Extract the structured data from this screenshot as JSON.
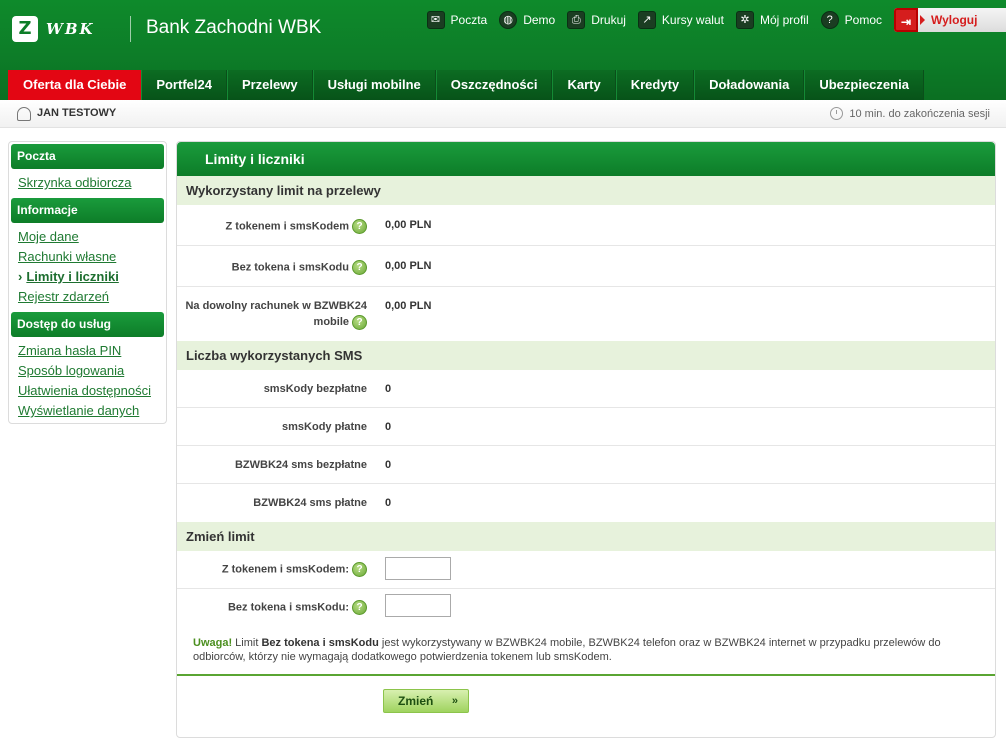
{
  "header": {
    "logo_mark": "Z",
    "logo_wordmark": "WBK",
    "bank_name": "Bank Zachodni WBK",
    "top_links": [
      {
        "label": "Poczta",
        "icon": "envelope-icon",
        "glyph": "✉"
      },
      {
        "label": "Demo",
        "icon": "globe-icon",
        "glyph": "◍"
      },
      {
        "label": "Drukuj",
        "icon": "printer-icon",
        "glyph": "⎙"
      },
      {
        "label": "Kursy walut",
        "icon": "chart-icon",
        "glyph": "↗"
      },
      {
        "label": "Mój profil",
        "icon": "gear-icon",
        "glyph": "✲"
      },
      {
        "label": "Pomoc",
        "icon": "help-icon",
        "glyph": "?"
      }
    ],
    "logout": {
      "label": "Wyloguj",
      "icon": "logout-icon",
      "glyph": "⇥"
    }
  },
  "nav": {
    "tabs": [
      {
        "label": "Oferta dla Ciebie",
        "active": true
      },
      {
        "label": "Portfel24"
      },
      {
        "label": "Przelewy"
      },
      {
        "label": "Usługi mobilne"
      },
      {
        "label": "Oszczędności"
      },
      {
        "label": "Karty"
      },
      {
        "label": "Kredyty"
      },
      {
        "label": "Doładowania"
      },
      {
        "label": "Ubezpieczenia"
      }
    ]
  },
  "userbar": {
    "user_name": "JAN TESTOWY",
    "session": "10 min. do zakończenia sesji"
  },
  "sidebar": {
    "groups": [
      {
        "title": "Poczta",
        "items": [
          "Skrzynka odbiorcza"
        ]
      },
      {
        "title": "Informacje",
        "items": [
          "Moje dane",
          "Rachunki własne",
          "Limity i liczniki",
          "Rejestr zdarzeń"
        ]
      },
      {
        "title": "Dostęp do usług",
        "items": [
          "Zmiana hasła PIN",
          "Sposób logowania",
          "Ułatwienia dostępności",
          "Wyświetlanie danych"
        ]
      }
    ],
    "active_item": "Limity i liczniki",
    "active_chevron": "›"
  },
  "main": {
    "title": "Limity i liczniki",
    "section1": {
      "title": "Wykorzystany limit na przelewy",
      "rows": [
        {
          "label": "Z tokenem i smsKodem",
          "value": "0,00 PLN"
        },
        {
          "label": "Bez tokena i smsKodu",
          "value": "0,00 PLN"
        },
        {
          "label": "Na dowolny rachunek w BZWBK24 mobile",
          "value": "0,00 PLN"
        }
      ]
    },
    "section2": {
      "title": "Liczba wykorzystanych SMS",
      "rows": [
        {
          "label": "smsKody bezpłatne",
          "value": "0"
        },
        {
          "label": "smsKody płatne",
          "value": "0"
        },
        {
          "label": "BZWBK24 sms bezpłatne",
          "value": "0"
        },
        {
          "label": "BZWBK24 sms płatne",
          "value": "0"
        }
      ]
    },
    "section3": {
      "title": "Zmień limit",
      "rows": [
        {
          "label": "Z tokenem i smsKodem:",
          "value": ""
        },
        {
          "label": "Bez tokena i smsKodu:",
          "value": ""
        }
      ]
    },
    "notice": {
      "warn": "Uwaga!",
      "part1": " Limit ",
      "strong": "Bez tokena i smsKodu",
      "part2": " jest wykorzystywany w BZWBK24 mobile, BZWBK24 telefon oraz w BZWBK24 internet w przypadku przelewów do odbiorców, którzy nie wymagają dodatkowego potwierdzenia tokenem lub smsKodem."
    },
    "submit": {
      "label": "Zmień",
      "arrows": "»"
    },
    "help_glyph": "?"
  }
}
